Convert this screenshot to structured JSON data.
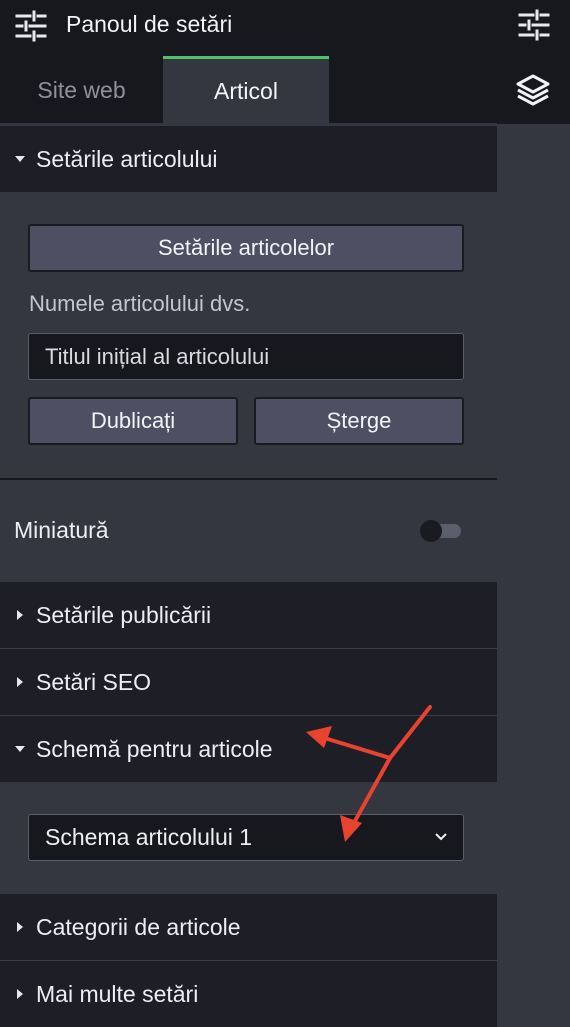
{
  "header": {
    "title": "Panoul de setări",
    "left_icon": "sliders-icon",
    "right_icon": "sliders-icon"
  },
  "rail": {
    "icon": "layers-icon"
  },
  "tabs": [
    {
      "label": "Site web",
      "active": false
    },
    {
      "label": "Articol",
      "active": true
    }
  ],
  "article_settings": {
    "header": "Setările articolului",
    "settings_button": "Setările articolelor",
    "name_label": "Numele articolului dvs.",
    "name_value": "Titlul inițial al articolului",
    "duplicate_button": "Dublicați",
    "delete_button": "Șterge"
  },
  "thumbnail": {
    "label": "Miniatură",
    "enabled": false
  },
  "sections": {
    "publishing": "Setările publicării",
    "seo": "Setări SEO",
    "schema": "Schemă pentru articole",
    "categories": "Categorii de articole",
    "more": "Mai multe setări"
  },
  "schema_select": {
    "value": "Schema articolului 1"
  },
  "colors": {
    "accent_tab": "#4cc36b",
    "annotation_arrow": "#e8432e",
    "panel": "#343640",
    "header_bg": "#1e1f26"
  }
}
